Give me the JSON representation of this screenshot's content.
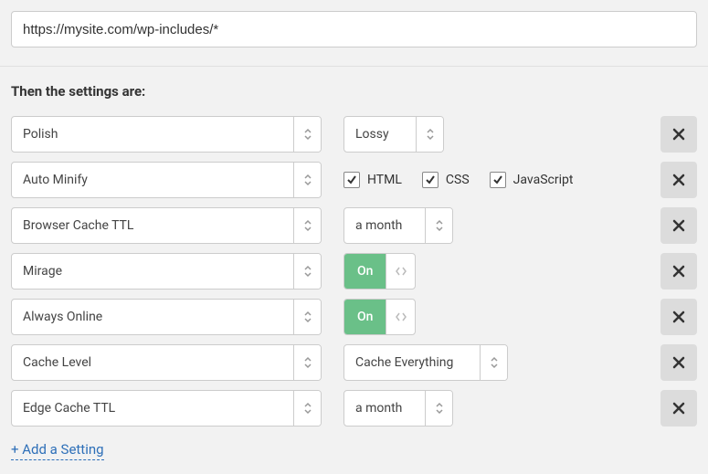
{
  "url_value": "https://mysite.com/wp-includes/*",
  "section_title": "Then the settings are:",
  "rows": [
    {
      "setting": "Polish",
      "value_type": "select",
      "value": "Lossy"
    },
    {
      "setting": "Auto Minify",
      "value_type": "checks",
      "checks": [
        {
          "label": "HTML",
          "checked": true
        },
        {
          "label": "CSS",
          "checked": true
        },
        {
          "label": "JavaScript",
          "checked": true
        }
      ]
    },
    {
      "setting": "Browser Cache TTL",
      "value_type": "select",
      "value": "a month"
    },
    {
      "setting": "Mirage",
      "value_type": "toggle",
      "value": "On"
    },
    {
      "setting": "Always Online",
      "value_type": "toggle",
      "value": "On"
    },
    {
      "setting": "Cache Level",
      "value_type": "select",
      "value": "Cache Everything"
    },
    {
      "setting": "Edge Cache TTL",
      "value_type": "select",
      "value": "a month"
    }
  ],
  "add_setting_label": "+ Add a Setting"
}
